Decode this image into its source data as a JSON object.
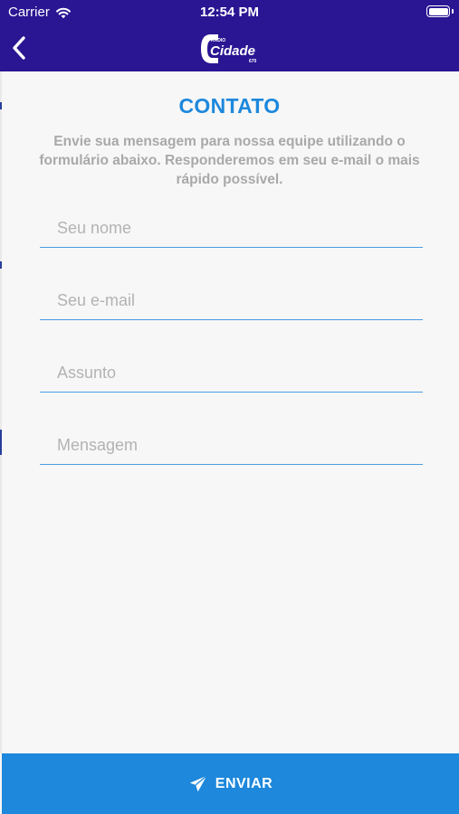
{
  "status_bar": {
    "carrier": "Carrier",
    "time": "12:54 PM",
    "wifi_icon": "wifi-icon",
    "battery_icon": "battery-icon"
  },
  "nav_bar": {
    "back_icon": "chevron-left-icon",
    "logo": {
      "small_text": "RÁDIO",
      "name": "Cidade",
      "frequency": "670"
    },
    "background_color": "#2a1593"
  },
  "form": {
    "title": "CONTATO",
    "subtitle": "Envie sua mensagem para nossa equipe utilizando o formulário abaixo. Responderemos em seu e-mail o mais rápido possível.",
    "fields": {
      "name": {
        "placeholder": "Seu nome",
        "value": ""
      },
      "email": {
        "placeholder": "Seu e-mail",
        "value": ""
      },
      "subject": {
        "placeholder": "Assunto",
        "value": ""
      },
      "message": {
        "placeholder": "Mensagem",
        "value": ""
      }
    },
    "accent_color": "#1d88dc"
  },
  "send_button": {
    "label": "ENVIAR",
    "icon": "paper-plane-icon"
  }
}
